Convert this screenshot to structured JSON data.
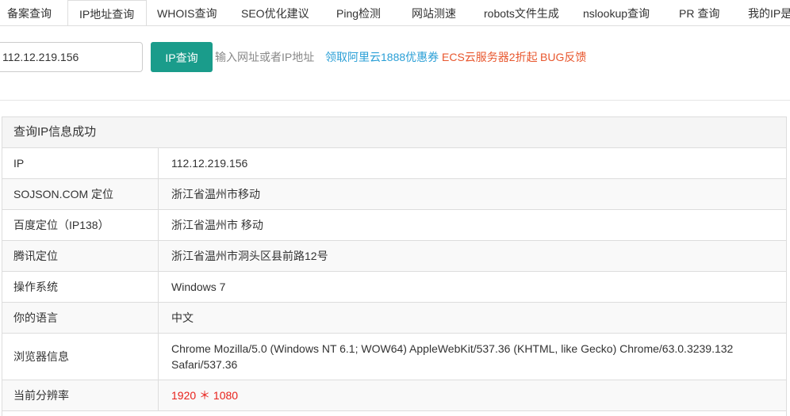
{
  "tabs": [
    {
      "label": "备案查询",
      "active": false
    },
    {
      "label": "IP地址查询",
      "active": true
    },
    {
      "label": "WHOIS查询",
      "active": false
    },
    {
      "label": "SEO优化建议",
      "active": false
    },
    {
      "label": "Ping检测",
      "active": false
    },
    {
      "label": "网站测速",
      "active": false
    },
    {
      "label": "robots文件生成",
      "active": false
    },
    {
      "label": "nslookup查询",
      "active": false
    },
    {
      "label": "PR 查询",
      "active": false
    },
    {
      "label": "我的IP是",
      "active": false
    }
  ],
  "query": {
    "input_value": "112.12.219.156",
    "button_label": "IP查询",
    "hint": "输入网址或者IP地址",
    "promo_aliyun": "领取阿里云1888优惠券",
    "promo_ecs": "ECS云服务器2折起",
    "promo_bug": "BUG反馈"
  },
  "result": {
    "title": "查询IP信息成功",
    "rows": [
      {
        "label": "IP",
        "value": "112.12.219.156"
      },
      {
        "label": "SOJSON.COM 定位",
        "value": "浙江省温州市移动"
      },
      {
        "label": "百度定位（IP138）",
        "value": "浙江省温州市 移动"
      },
      {
        "label": "腾讯定位",
        "value": "浙江省温州市洞头区县前路12号"
      },
      {
        "label": "操作系统",
        "value": "Windows 7"
      },
      {
        "label": "你的语言",
        "value": "中文"
      },
      {
        "label": "浏览器信息",
        "value": "Chrome Mozilla/5.0 (Windows NT 6.1; WOW64) AppleWebKit/537.36 (KHTML, like Gecko) Chrome/63.0.3239.132 Safari/537.36"
      },
      {
        "label": "当前分辨率",
        "value": "1920 ＊ 1080"
      }
    ]
  },
  "colors": {
    "button_bg": "#1a9c8b",
    "link_blue": "#2a9fd6",
    "link_orange": "#e8572e",
    "resolution_red": "#e8211b"
  }
}
